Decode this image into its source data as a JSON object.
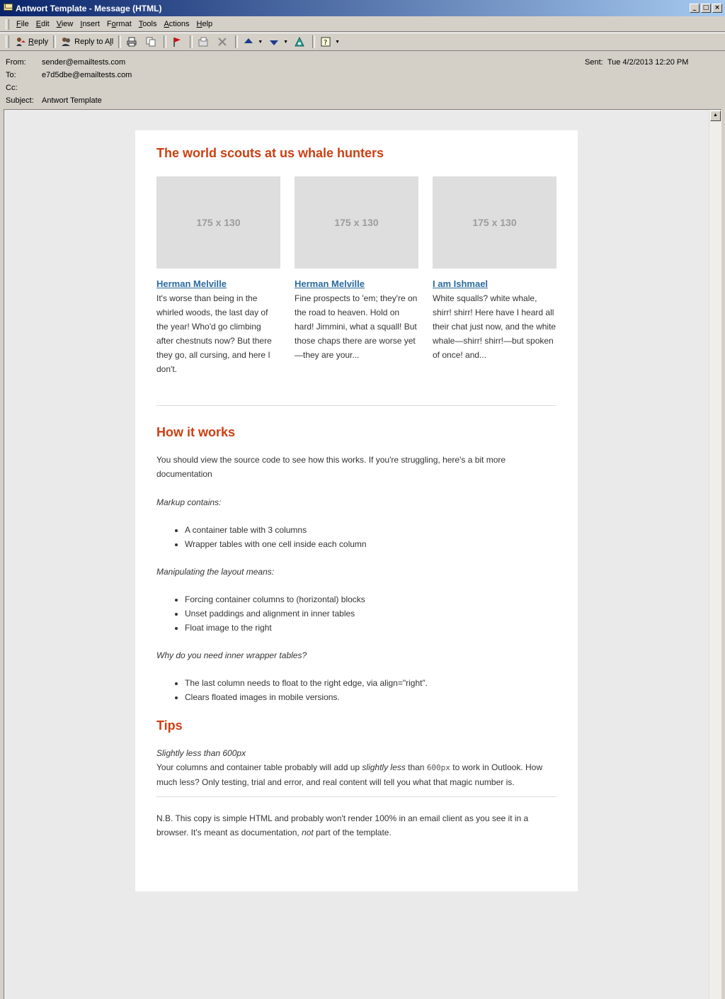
{
  "window": {
    "title": "Antwort Template - Message (HTML)",
    "controls": [
      "_",
      "□",
      "×"
    ]
  },
  "menu": [
    {
      "key": "F",
      "rest": "ile"
    },
    {
      "key": "E",
      "rest": "dit"
    },
    {
      "key": "V",
      "rest": "iew"
    },
    {
      "key": "I",
      "rest": "nsert"
    },
    {
      "key": "F",
      "rest": "ormat",
      "prefix": "",
      "note": "Format"
    },
    {
      "key": "T",
      "rest": "ools"
    },
    {
      "key": "A",
      "rest": "ctions"
    },
    {
      "key": "H",
      "rest": "elp"
    }
  ],
  "toolbar": {
    "reply_key": "R",
    "reply_rest": "eply",
    "reply_all_pre": "Reply to A",
    "reply_all_key": "l",
    "reply_all_post": "l"
  },
  "header": {
    "from_label": "From:",
    "from_value": "sender@emailtests.com",
    "to_label": "To:",
    "to_value": "e7d5dbe@emailtests.com",
    "cc_label": "Cc:",
    "cc_value": "",
    "subject_label": "Subject:",
    "subject_value": "Antwort Template",
    "sent_label": "Sent:",
    "sent_value": "Tue 4/2/2013 12:20 PM"
  },
  "email": {
    "heading": "The world scouts at us whale hunters",
    "columns": [
      {
        "placeholder": "175 x 130",
        "title": "Herman Melville",
        "text": "It's worse than being in the whirled woods, the last day of the year! Who'd go climbing after chestnuts now? But there they go, all cursing, and here I don't."
      },
      {
        "placeholder": "175 x 130",
        "title": "Herman Melville",
        "text": "Fine prospects to 'em; they're on the road to heaven. Hold on hard! Jimmini, what a squall! But those chaps there are worse yet—they are your..."
      },
      {
        "placeholder": "175 x 130",
        "title": "I am Ishmael",
        "text": "White squalls? white whale, shirr! shirr! Here have I heard all their chat just now, and the white whale—shirr! shirr!—but spoken of once! and..."
      }
    ],
    "how_heading": "How it works",
    "how_intro": "You should view the source code to see how this works. If you're struggling, here's a bit more documentation",
    "markup_label": "Markup contains:",
    "markup_items": [
      "A container table with 3 columns",
      "Wrapper tables with one cell inside each column"
    ],
    "manip_label": "Manipulating the layout means:",
    "manip_items": [
      "Forcing container columns to (horizontal) blocks",
      "Unset paddings and alignment in inner tables",
      "Float image to the right"
    ],
    "why_label": "Why do you need inner wrapper tables?",
    "why_items": [
      "The last column needs to float to the right edge, via align=\"right\".",
      "Clears floated images in mobile versions."
    ],
    "tips_heading": "Tips",
    "tip_title": "Slightly less than 600px",
    "tip_text_1": "Your columns and container table probably will add up ",
    "tip_text_em": "slightly less",
    "tip_text_2": " than ",
    "tip_code": "600px",
    "tip_text_3": " to work in Outlook. How much less? Only testing, trial and error, and real content will tell you what that magic number is.",
    "note_1": "N.B. This copy is simple HTML and probably won't render 100% in an email client as you see it in a browser. It's meant as documentation, ",
    "note_em": "not",
    "note_2": " part of the template."
  },
  "colors": {
    "heading": "#cc3f12",
    "link": "#2a6a9e",
    "placeholder_bg": "#dedede",
    "titlebar_start": "#0a246a",
    "titlebar_end": "#a6caf0"
  }
}
